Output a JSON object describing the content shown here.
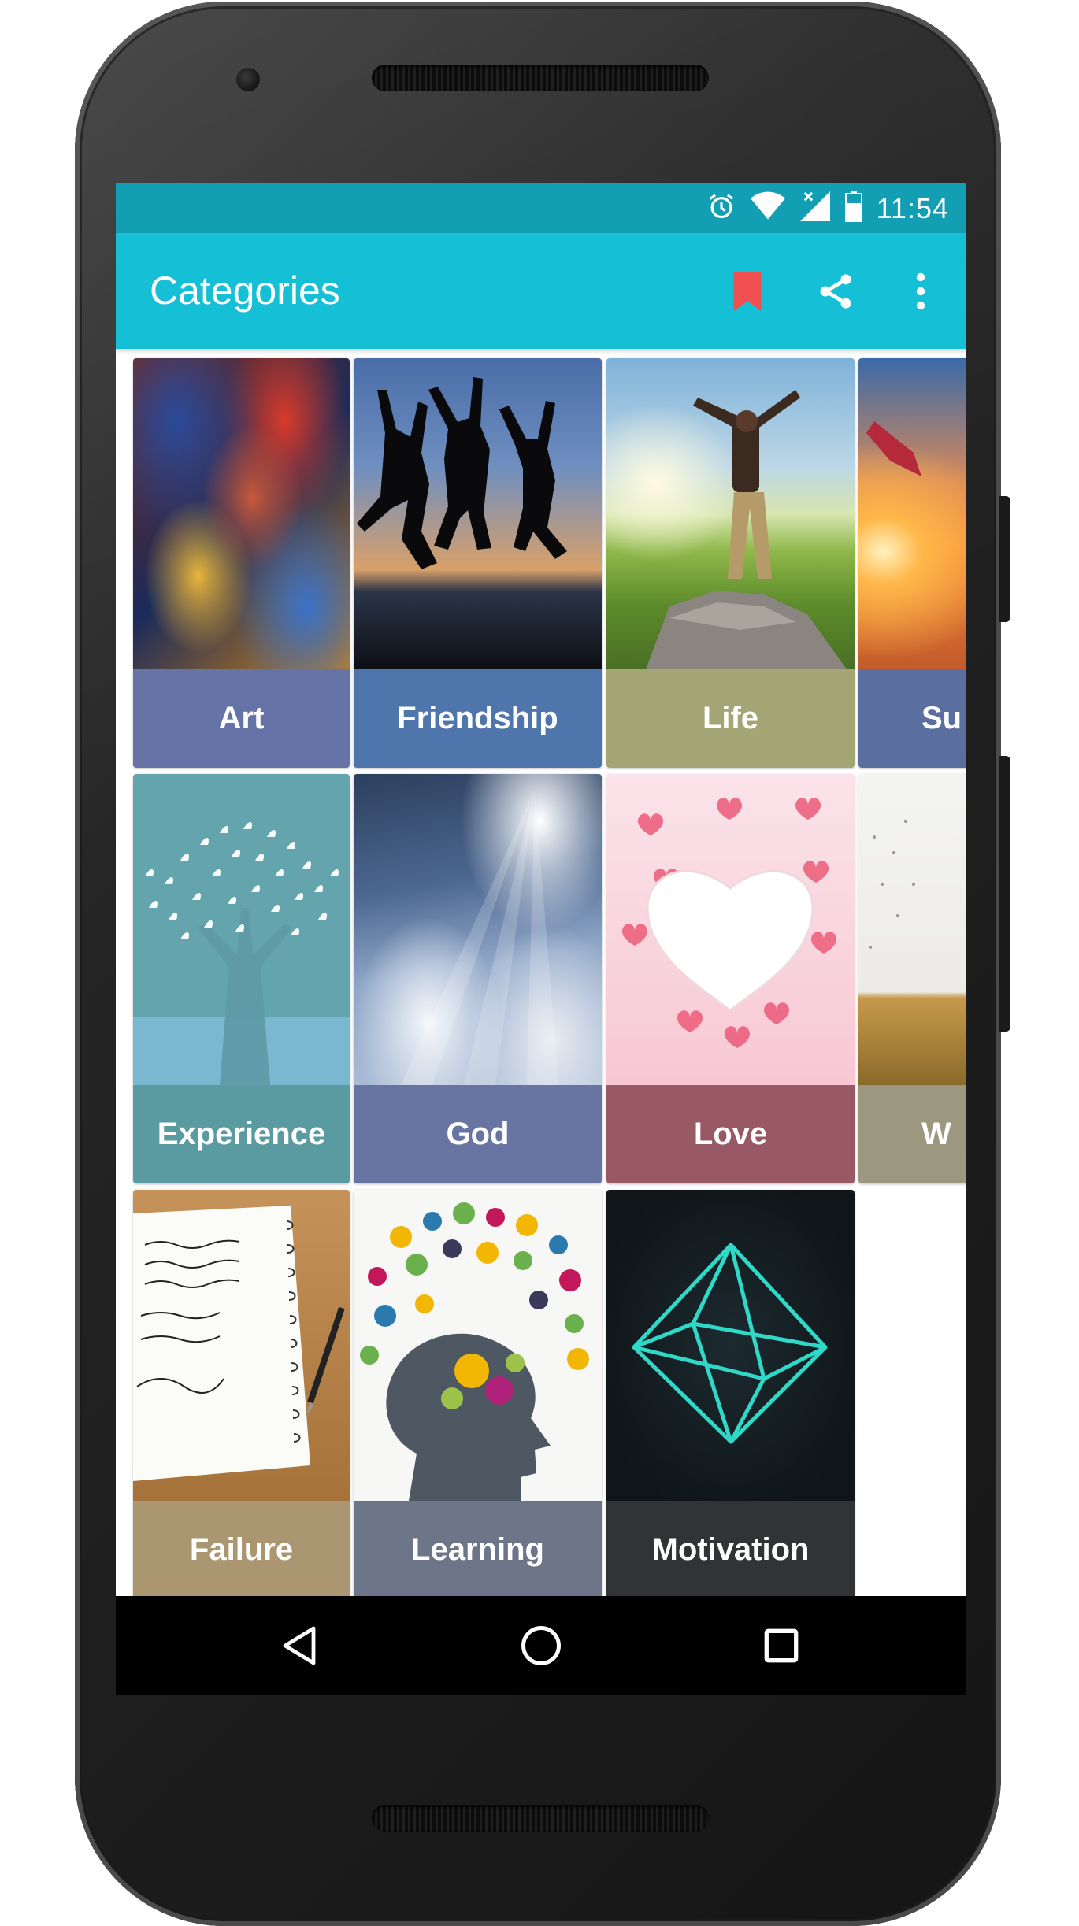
{
  "status": {
    "time": "11:54"
  },
  "appbar": {
    "title": "Categories",
    "accent": "#15bfd6",
    "bookmark_color": "#f05050"
  },
  "categories": [
    {
      "label": "Art",
      "color": "#6673a6"
    },
    {
      "label": "Friendship",
      "color": "#4f75ad"
    },
    {
      "label": "Life",
      "color": "#a3a674"
    },
    {
      "label": "Su",
      "color": "#5a6fa0"
    },
    {
      "label": "Experience",
      "color": "#5a9ba2"
    },
    {
      "label": "God",
      "color": "#6875a2"
    },
    {
      "label": "Love",
      "color": "#985965"
    },
    {
      "label": "W",
      "color": "#9c977f"
    },
    {
      "label": "Failure",
      "color": "#aa9670"
    },
    {
      "label": "Learning",
      "color": "#6d7589"
    },
    {
      "label": "Motivation",
      "color": "#323334"
    }
  ],
  "icons": [
    "alarm-icon",
    "wifi-icon",
    "signal-icon",
    "battery-icon",
    "bookmark-icon",
    "share-icon",
    "more-vert-icon",
    "back-icon",
    "home-icon",
    "recents-icon"
  ]
}
